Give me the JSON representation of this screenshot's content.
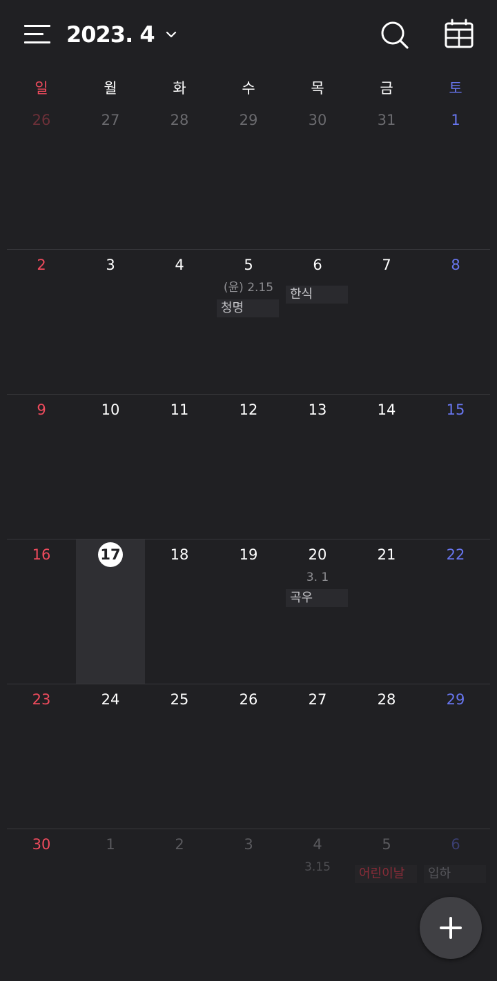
{
  "header": {
    "title": "2023. 4",
    "menu_icon": "hamburger-menu-icon",
    "dropdown_icon": "chevron-down-icon",
    "search_icon": "search-icon",
    "view_icon": "calendar-grid-icon"
  },
  "weekdays": [
    "일",
    "월",
    "화",
    "수",
    "목",
    "금",
    "토"
  ],
  "weeks": [
    {
      "days": [
        {
          "num": "26",
          "tone": "dim"
        },
        {
          "num": "27",
          "tone": "dim"
        },
        {
          "num": "28",
          "tone": "dim"
        },
        {
          "num": "29",
          "tone": "dim"
        },
        {
          "num": "30",
          "tone": "dim"
        },
        {
          "num": "31",
          "tone": "dim"
        },
        {
          "num": "1",
          "tone": "normal"
        }
      ]
    },
    {
      "days": [
        {
          "num": "2",
          "tone": "normal"
        },
        {
          "num": "3",
          "tone": "normal"
        },
        {
          "num": "4",
          "tone": "normal"
        },
        {
          "num": "5",
          "tone": "normal",
          "lunar": "(윤) 2.15",
          "events": [
            {
              "label": "청명",
              "kind": "term"
            }
          ]
        },
        {
          "num": "6",
          "tone": "normal",
          "events": [
            {
              "label": "한식",
              "kind": "term"
            }
          ]
        },
        {
          "num": "7",
          "tone": "normal"
        },
        {
          "num": "8",
          "tone": "normal"
        }
      ]
    },
    {
      "days": [
        {
          "num": "9",
          "tone": "normal"
        },
        {
          "num": "10",
          "tone": "normal"
        },
        {
          "num": "11",
          "tone": "normal"
        },
        {
          "num": "12",
          "tone": "normal"
        },
        {
          "num": "13",
          "tone": "normal"
        },
        {
          "num": "14",
          "tone": "normal"
        },
        {
          "num": "15",
          "tone": "normal"
        }
      ]
    },
    {
      "days": [
        {
          "num": "16",
          "tone": "normal"
        },
        {
          "num": "17",
          "tone": "normal",
          "today": true
        },
        {
          "num": "18",
          "tone": "normal"
        },
        {
          "num": "19",
          "tone": "normal"
        },
        {
          "num": "20",
          "tone": "normal",
          "lunar": "3. 1",
          "events": [
            {
              "label": "곡우",
              "kind": "term"
            }
          ]
        },
        {
          "num": "21",
          "tone": "normal"
        },
        {
          "num": "22",
          "tone": "normal"
        }
      ]
    },
    {
      "days": [
        {
          "num": "23",
          "tone": "normal"
        },
        {
          "num": "24",
          "tone": "normal"
        },
        {
          "num": "25",
          "tone": "normal"
        },
        {
          "num": "26",
          "tone": "normal"
        },
        {
          "num": "27",
          "tone": "normal"
        },
        {
          "num": "28",
          "tone": "normal"
        },
        {
          "num": "29",
          "tone": "normal"
        }
      ]
    },
    {
      "days": [
        {
          "num": "30",
          "tone": "normal"
        },
        {
          "num": "1",
          "tone": "faded"
        },
        {
          "num": "2",
          "tone": "faded"
        },
        {
          "num": "3",
          "tone": "faded"
        },
        {
          "num": "4",
          "tone": "faded",
          "lunar": "3.15"
        },
        {
          "num": "5",
          "tone": "faded",
          "events": [
            {
              "label": "어린이날",
              "kind": "holiday"
            }
          ]
        },
        {
          "num": "6",
          "tone": "faded",
          "events": [
            {
              "label": "입하",
              "kind": "dim"
            }
          ]
        }
      ]
    }
  ],
  "fab": {
    "icon": "plus-icon"
  },
  "colors": {
    "background": "#202023",
    "sunday": "#ef4b5d",
    "saturday": "#6876f0",
    "today_highlight": "#2f2f33"
  }
}
